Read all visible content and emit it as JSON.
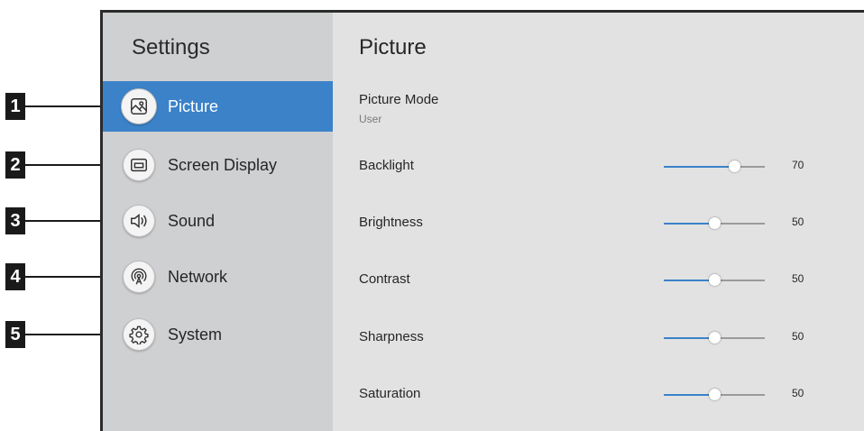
{
  "sidebar": {
    "title": "Settings",
    "items": [
      {
        "label": "Picture",
        "icon": "picture-icon",
        "callout": "1",
        "active": true
      },
      {
        "label": "Screen Display",
        "icon": "screen-display-icon",
        "callout": "2"
      },
      {
        "label": "Sound",
        "icon": "speaker-icon",
        "callout": "3"
      },
      {
        "label": "Network",
        "icon": "network-icon",
        "callout": "4"
      },
      {
        "label": "System",
        "icon": "gear-icon",
        "callout": "5"
      }
    ]
  },
  "main": {
    "title": "Picture",
    "picture_mode": {
      "label": "Picture Mode",
      "value": "User"
    },
    "settings": [
      {
        "label": "Backlight",
        "value": "70"
      },
      {
        "label": "Brightness",
        "value": "50"
      },
      {
        "label": "Contrast",
        "value": "50"
      },
      {
        "label": "Sharpness",
        "value": "50"
      },
      {
        "label": "Saturation",
        "value": "50"
      }
    ]
  },
  "colors": {
    "accent": "#3b82c9",
    "sidebar_bg": "#cfd0d2",
    "content_bg": "#e2e2e2"
  }
}
